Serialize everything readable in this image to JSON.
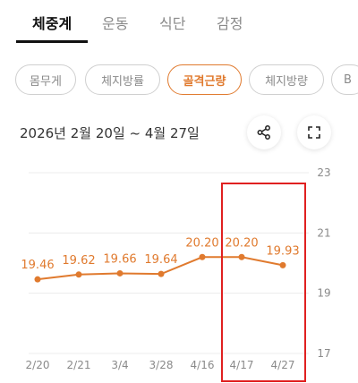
{
  "tabs": [
    {
      "label": "체중계",
      "active": true
    },
    {
      "label": "운동",
      "active": false
    },
    {
      "label": "식단",
      "active": false
    },
    {
      "label": "감정",
      "active": false
    }
  ],
  "chips": [
    {
      "label": "몸무게",
      "active": false
    },
    {
      "label": "체지방률",
      "active": false
    },
    {
      "label": "골격근량",
      "active": true
    },
    {
      "label": "체지방량",
      "active": false
    },
    {
      "label": "B",
      "active": false
    }
  ],
  "date_range": "2026년 2월 20일 ~ 4월 27일",
  "icons": {
    "share": "share-icon",
    "expand": "expand-icon"
  },
  "colors": {
    "accent": "#e07a2e",
    "highlight": "#e02020"
  },
  "chart_data": {
    "type": "line",
    "categories": [
      "2/20",
      "2/21",
      "3/4",
      "3/28",
      "4/16",
      "4/17",
      "4/27"
    ],
    "values": [
      19.46,
      19.62,
      19.66,
      19.64,
      20.2,
      20.2,
      19.93
    ],
    "value_labels": [
      "19.46",
      "19.62",
      "19.66",
      "19.64",
      "20.20",
      "20.20",
      "19.93"
    ],
    "y_ticks": [
      23,
      21,
      19,
      17
    ],
    "ylim": [
      17,
      23
    ],
    "highlight_categories": [
      "4/17",
      "4/27"
    ],
    "grid": true
  }
}
